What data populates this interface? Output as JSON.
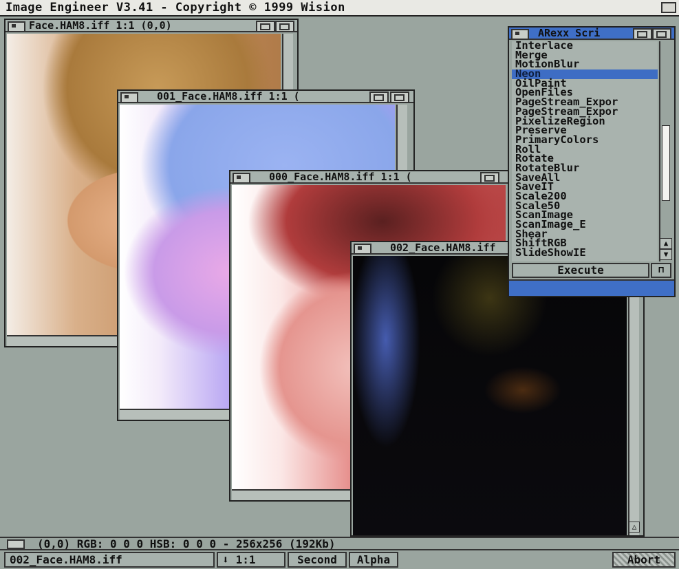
{
  "screen": {
    "title": "Image Engineer V3.41 - Copyright © 1999 Wision"
  },
  "windows": [
    {
      "title": "Face.HAM8.iff 1:1 (0,0)"
    },
    {
      "title": "001_Face.HAM8.iff 1:1 ("
    },
    {
      "title": "000_Face.HAM8.iff 1:1 ("
    },
    {
      "title": "002_Face.HAM8.iff"
    }
  ],
  "arexx": {
    "title": "ARexx Scri",
    "items": [
      "Interlace",
      "Merge",
      "MotionBlur",
      "Neon",
      "OilPaint",
      "OpenFiles",
      "PageStream_Expor",
      "PageStream_Expor",
      "PixelizeRegion",
      "Preserve",
      "PrimaryColors",
      "Roll",
      "Rotate",
      "RotateBlur",
      "SaveAll",
      "SaveIT",
      "Scale200",
      "Scale50",
      "ScanImage",
      "ScanImage_E",
      "Shear",
      "ShiftRGB",
      "SlideShowIE"
    ],
    "selected": "Neon",
    "execute_label": "Execute"
  },
  "status": {
    "text": "(0,0) RGB: 0 0 0 HSB: 0 0 0 - 256x256 (192Kb)"
  },
  "toolbar": {
    "current_file": "002_Face.HAM8.iff",
    "zoom_icon": "down-arrow-icon",
    "zoom_glyph": "⬇",
    "zoom_label": "1:1",
    "second_label": "Second",
    "alpha_label": "Alpha",
    "abort_label": "Abort"
  },
  "colors": {
    "background": "#9aa59f",
    "selection": "#3e6dc4"
  }
}
